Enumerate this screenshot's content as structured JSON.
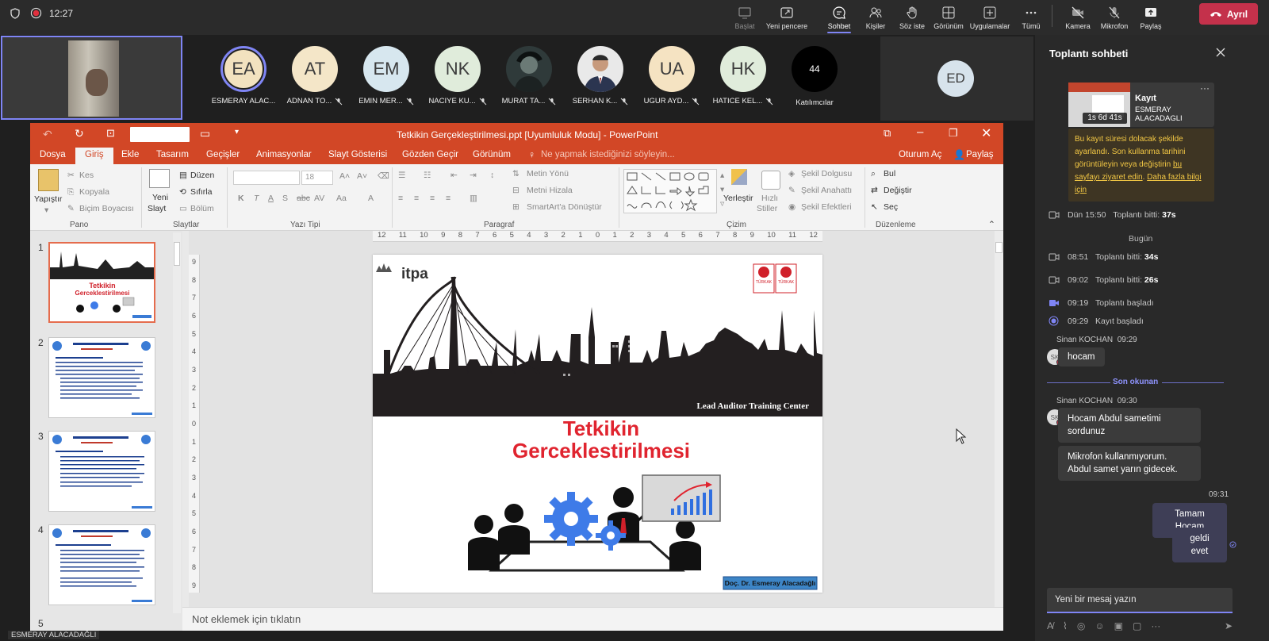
{
  "system": {
    "time": "12:27"
  },
  "toolbar": {
    "items": [
      {
        "label": "Başlat",
        "icon": "record-icon"
      },
      {
        "label": "Yeni pencere",
        "icon": "new-window-icon"
      },
      {
        "label": "Sohbet",
        "icon": "chat-icon"
      },
      {
        "label": "Kişiler",
        "icon": "people-icon"
      },
      {
        "label": "Söz iste",
        "icon": "raise-hand-icon"
      },
      {
        "label": "Görünüm",
        "icon": "view-grid-icon"
      },
      {
        "label": "Uygulamalar",
        "icon": "apps-plus-icon"
      },
      {
        "label": "Tümü",
        "icon": "more-icon"
      },
      {
        "label": "Kamera",
        "icon": "camera-off-icon"
      },
      {
        "label": "Mikrofon",
        "icon": "mic-off-icon"
      },
      {
        "label": "Paylaş",
        "icon": "share-icon"
      }
    ],
    "leave_label": "Ayrıl",
    "colors": {
      "leave": "#c4314b",
      "accent": "#7f85f5"
    }
  },
  "participants": [
    {
      "initials": "EA",
      "name": "ESMERAY ALAC...",
      "color": "#f2e2bf"
    },
    {
      "initials": "AT",
      "name": "ADNAN TO...",
      "color": "#f4e6c8"
    },
    {
      "initials": "EM",
      "name": "EMIN MER...",
      "color": "#d7e7ef"
    },
    {
      "initials": "NK",
      "name": "NACIYE KU...",
      "color": "#e0ecdb"
    },
    {
      "initials": "",
      "name": "MURAT TA...",
      "color": "#3a3a3a"
    },
    {
      "initials": "",
      "name": "SERHAN K...",
      "color": "#d8d8d8"
    },
    {
      "initials": "UA",
      "name": "UGUR AYD...",
      "color": "#f5e3c2"
    },
    {
      "initials": "HK",
      "name": "HATICE KEL...",
      "color": "#e0ecdb"
    }
  ],
  "participants_more": {
    "count": "44",
    "label": "Katılımcılar"
  },
  "side_tile": {
    "initials": "ED"
  },
  "self_view_label": "ESMERAY ALACADAĞLI",
  "ppt": {
    "title": "Tetkikin Gerçekleştirilmesi.ppt [Uyumluluk Modu] - PowerPoint",
    "signin": "Oturum Aç",
    "share": "Paylaş",
    "tabs": [
      "Dosya",
      "Giriş",
      "Ekle",
      "Tasarım",
      "Geçişler",
      "Animasyonlar",
      "Slayt Gösterisi",
      "Gözden Geçir",
      "Görünüm"
    ],
    "tellme": "Ne yapmak istediğinizi söyleyin...",
    "ribbon": {
      "paste": "Yapıştır",
      "cut": "Kes",
      "copy": "Kopyala",
      "format_painter": "Biçim Boyacısı",
      "group_clipboard": "Pano",
      "new_slide_1": "Yeni",
      "new_slide_2": "Slayt",
      "layout": "Düzen",
      "reset": "Sıfırla",
      "section": "Bölüm",
      "group_slides": "Slaytlar",
      "font_size": "18",
      "group_font": "Yazı Tipi",
      "text_direction": "Metin Yönü",
      "align_text": "Metni Hizala",
      "smartart": "SmartArt'a Dönüştür",
      "group_paragraph": "Paragraf",
      "arrange": "Yerleştir",
      "quick_styles_1": "Hızlı",
      "quick_styles_2": "Stiller",
      "shape_fill": "Şekil Dolgusu",
      "shape_outline": "Şekil Anahattı",
      "shape_effects": "Şekil Efektleri",
      "group_drawing": "Çizim",
      "find": "Bul",
      "replace": "Değiştir",
      "select": "Seç",
      "group_editing": "Düzenleme"
    },
    "ruler_ticks": [
      "12",
      "11",
      "10",
      "9",
      "8",
      "7",
      "6",
      "5",
      "4",
      "3",
      "2",
      "1",
      "0",
      "1",
      "2",
      "3",
      "4",
      "5",
      "6",
      "7",
      "8",
      "9",
      "10",
      "11",
      "12"
    ],
    "vruler_ticks": [
      "9",
      "8",
      "7",
      "6",
      "5",
      "4",
      "3",
      "2",
      "1",
      "0",
      "1",
      "2",
      "3",
      "4",
      "5",
      "6",
      "7",
      "8",
      "9"
    ],
    "thumb_numbers": [
      "1",
      "2",
      "3",
      "4",
      "5"
    ],
    "notes_placeholder": "Not eklemek için tıklatın",
    "slide": {
      "logo": "itpa",
      "banner": "Lead Auditor Training Center",
      "title_line1": "Tetkikin",
      "title_line2": "Gerceklestirilmesi",
      "author": "Doç. Dr. Esmeray Alacadağlı",
      "badge": "TÜRKAK"
    }
  },
  "chat": {
    "title": "Toplantı sohbeti",
    "recording_card": {
      "title": "Kayıt",
      "owner": "ESMERAY ALACADAGLI",
      "duration": "1s 6d 41s"
    },
    "warning_lines": [
      "Bu kayıt süresi dolacak şekilde",
      "ayarlandı. Son kullanma tarihini",
      "görüntüleyin veya değiştirin "
    ],
    "warning_link1a": "bu",
    "warning_link1b": "sayfayı ziyaret edin",
    "warning_sep": ". ",
    "warning_link2a": "Daha fazla bilgi",
    "warning_link2b": "için",
    "events": [
      {
        "time": "Dün 15:50",
        "text": "Toplantı bitti:",
        "bold": "37s"
      },
      {
        "time": "08:51",
        "text": "Toplantı bitti:",
        "bold": "34s"
      },
      {
        "time": "09:02",
        "text": "Toplantı bitti:",
        "bold": "26s"
      },
      {
        "time": "09:19",
        "text": "Toplantı başladı",
        "bold": ""
      },
      {
        "time": "09:29",
        "text": "Kayıt başladı",
        "bold": ""
      }
    ],
    "today_label": "Bugün",
    "msg1": {
      "sender": "Sinan KOCHAN",
      "time": "09:29",
      "text": "hocam",
      "avatar": "SK"
    },
    "last_read": "Son okunan",
    "msg2": {
      "sender": "Sinan KOCHAN",
      "time": "09:30",
      "avatar": "SK",
      "line1": "Hocam Abdul sametimi",
      "line2": "sordunuz",
      "line3": "Mikrofon kullanmıyorum.",
      "line4": "Abdul samet yarın gidecek."
    },
    "my_time": "09:31",
    "my_msg1": "Tamam Hocam",
    "my_msg2": "geldi evet",
    "input_placeholder": "Yeni bir mesaj yazın"
  }
}
